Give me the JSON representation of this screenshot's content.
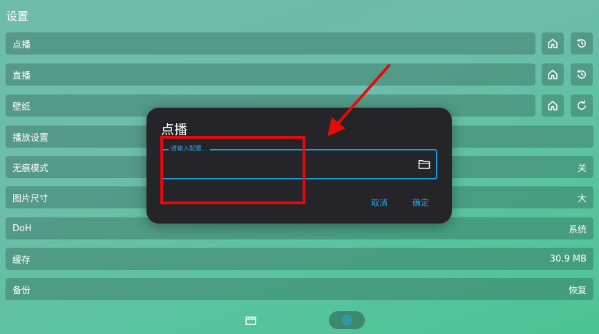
{
  "page": {
    "title": "设置"
  },
  "settings": {
    "rows": [
      {
        "label": "点播",
        "value": ""
      },
      {
        "label": "直播",
        "value": ""
      },
      {
        "label": "壁纸",
        "value": ""
      },
      {
        "label": "播放设置",
        "value": ""
      },
      {
        "label": "无痕模式",
        "value": "关"
      },
      {
        "label": "图片尺寸",
        "value": "大"
      },
      {
        "label": "DoH",
        "value": "系统"
      },
      {
        "label": "缓存",
        "value": "30.9 MB"
      },
      {
        "label": "备份",
        "value": "恢复"
      }
    ]
  },
  "dialog": {
    "title": "点播",
    "field_label": "请输入配置...",
    "field_value": "",
    "cancel_label": "取消",
    "confirm_label": "确定"
  },
  "icons": {
    "home": "home-icon",
    "history": "history-icon",
    "refresh": "refresh-icon",
    "folder": "folder-icon",
    "film": "film-icon",
    "gear": "gear-icon"
  },
  "colors": {
    "accent": "#1e9bd9",
    "annotation": "#e60a0a",
    "dialog_bg": "#252429"
  }
}
